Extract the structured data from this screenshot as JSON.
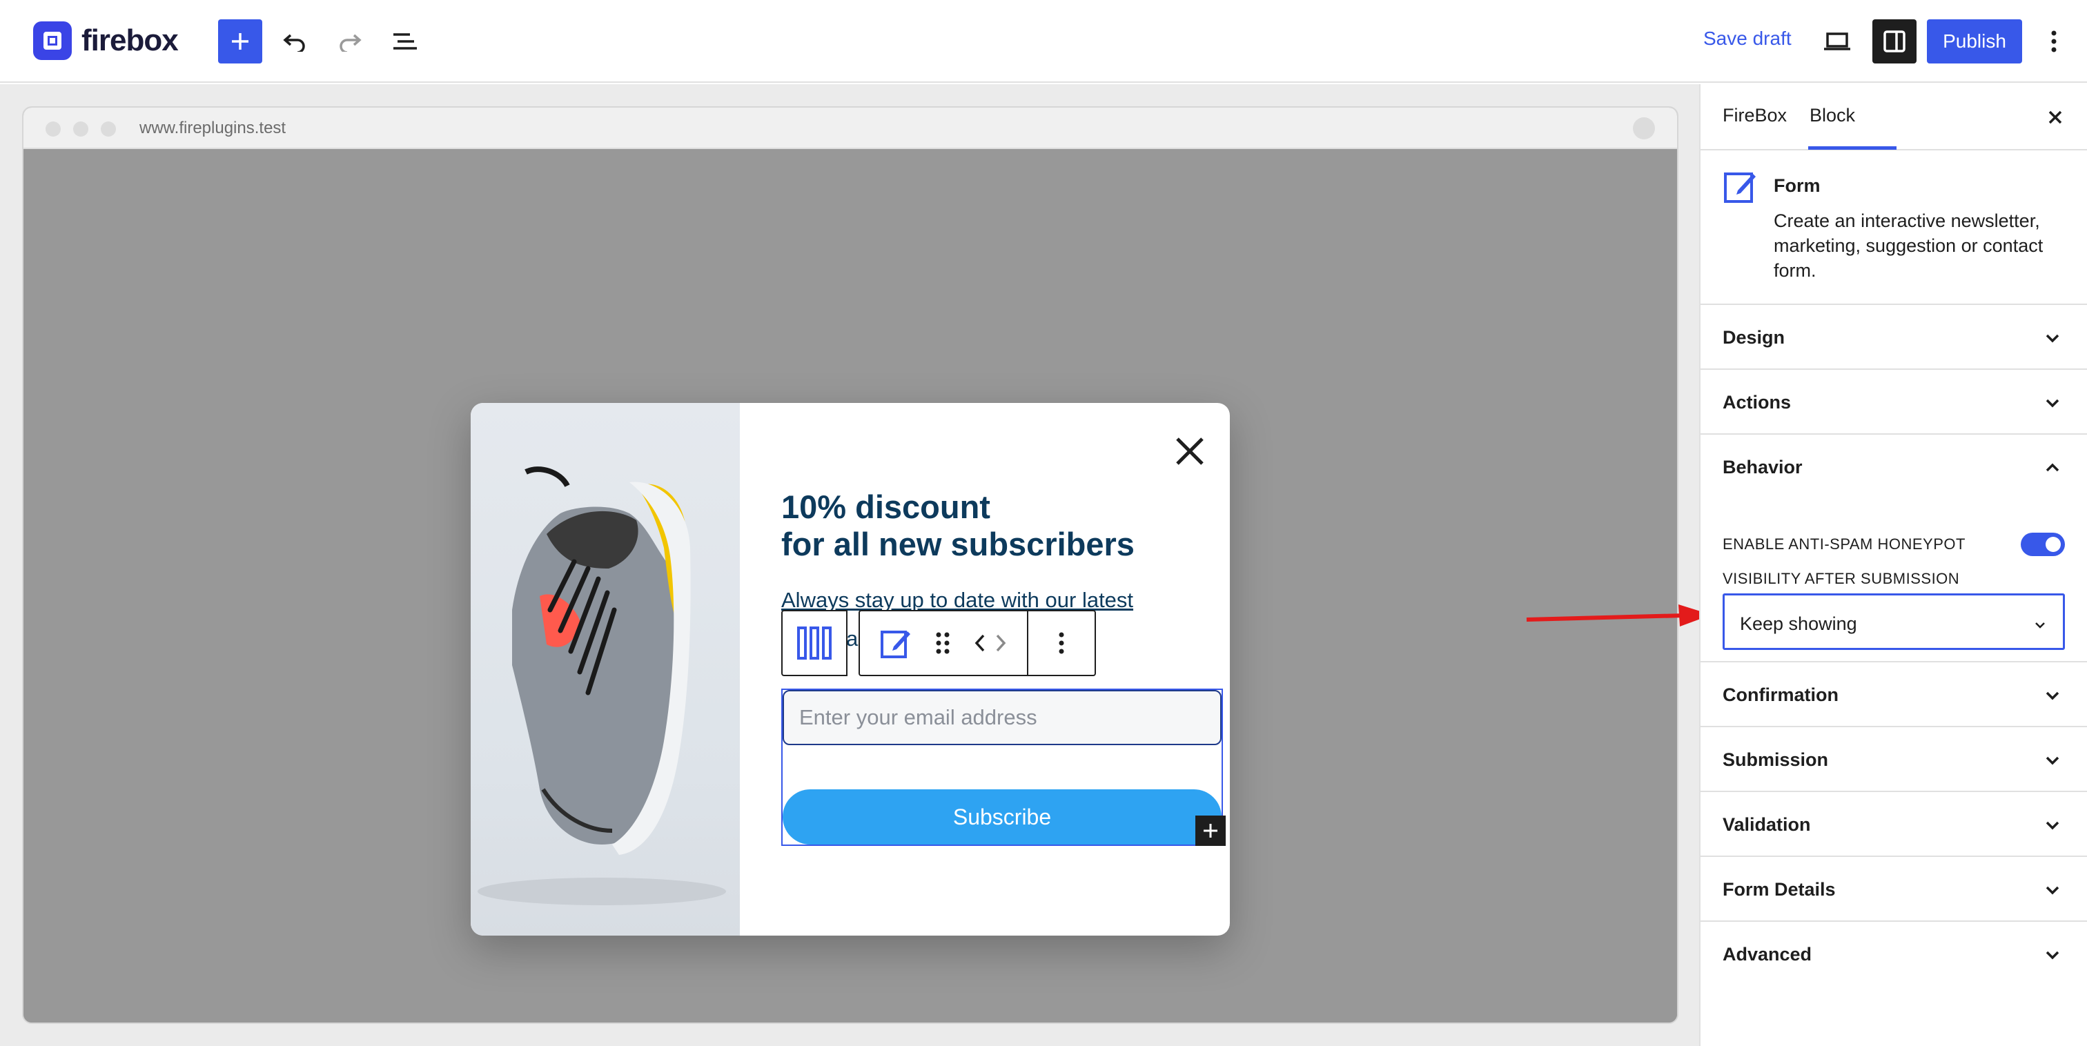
{
  "app": {
    "name": "firebox"
  },
  "toolbar": {
    "add_icon": "plus-icon",
    "undo_icon": "undo-icon",
    "redo_icon": "redo-icon",
    "list_view_icon": "list-view-icon",
    "save_draft_label": "Save draft",
    "preview_icon": "laptop-icon",
    "settings_icon": "sidebar-icon",
    "publish_label": "Publish",
    "more_icon": "vertical-ellipsis-icon"
  },
  "browser": {
    "url": "www.fireplugins.test"
  },
  "popup": {
    "headline_line1": "10% discount",
    "headline_line2": "for all new subscribers",
    "subtext": "Always stay up to date with our latest",
    "subtext_fragment": "a",
    "email_placeholder": "Enter your email address",
    "subscribe_label": "Subscribe"
  },
  "sidebar": {
    "tabs": [
      {
        "label": "FireBox",
        "active": false
      },
      {
        "label": "Block",
        "active": true
      }
    ],
    "block": {
      "name": "Form",
      "description": "Create an interactive newsletter, marketing, suggestion or contact form."
    },
    "panels": {
      "design": "Design",
      "actions": "Actions",
      "behavior": "Behavior",
      "confirmation": "Confirmation",
      "submission": "Submission",
      "validation": "Validation",
      "form_details": "Form Details",
      "advanced": "Advanced"
    },
    "behavior": {
      "honeypot_label": "ENABLE ANTI-SPAM HONEYPOT",
      "honeypot_enabled": true,
      "visibility_label": "VISIBILITY AFTER SUBMISSION",
      "visibility_value": "Keep showing"
    }
  },
  "colors": {
    "accent": "#3858e9",
    "headline": "#0d3a5c",
    "subscribe": "#2ea3f2",
    "arrow": "#e31b1b"
  }
}
